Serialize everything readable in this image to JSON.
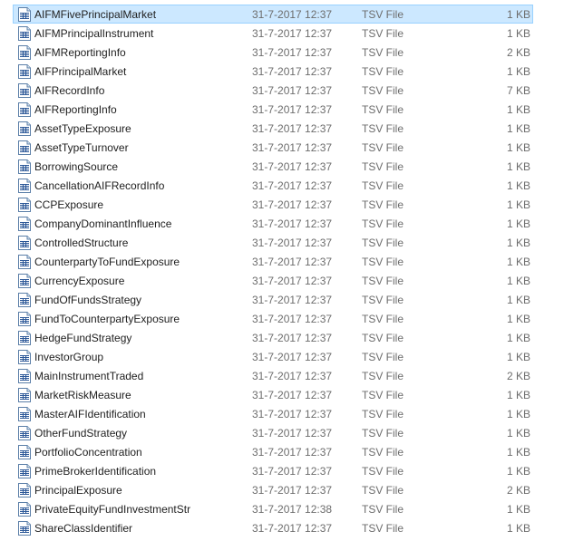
{
  "files": [
    {
      "name": "AIFMFivePrincipalMarket",
      "date": "31-7-2017 12:37",
      "type": "TSV File",
      "size": "1 KB",
      "selected": true
    },
    {
      "name": "AIFMPrincipalInstrument",
      "date": "31-7-2017 12:37",
      "type": "TSV File",
      "size": "1 KB"
    },
    {
      "name": "AIFMReportingInfo",
      "date": "31-7-2017 12:37",
      "type": "TSV File",
      "size": "2 KB"
    },
    {
      "name": "AIFPrincipalMarket",
      "date": "31-7-2017 12:37",
      "type": "TSV File",
      "size": "1 KB"
    },
    {
      "name": "AIFRecordInfo",
      "date": "31-7-2017 12:37",
      "type": "TSV File",
      "size": "7 KB"
    },
    {
      "name": "AIFReportingInfo",
      "date": "31-7-2017 12:37",
      "type": "TSV File",
      "size": "1 KB"
    },
    {
      "name": "AssetTypeExposure",
      "date": "31-7-2017 12:37",
      "type": "TSV File",
      "size": "1 KB"
    },
    {
      "name": "AssetTypeTurnover",
      "date": "31-7-2017 12:37",
      "type": "TSV File",
      "size": "1 KB"
    },
    {
      "name": "BorrowingSource",
      "date": "31-7-2017 12:37",
      "type": "TSV File",
      "size": "1 KB"
    },
    {
      "name": "CancellationAIFRecordInfo",
      "date": "31-7-2017 12:37",
      "type": "TSV File",
      "size": "1 KB"
    },
    {
      "name": "CCPExposure",
      "date": "31-7-2017 12:37",
      "type": "TSV File",
      "size": "1 KB"
    },
    {
      "name": "CompanyDominantInfluence",
      "date": "31-7-2017 12:37",
      "type": "TSV File",
      "size": "1 KB"
    },
    {
      "name": "ControlledStructure",
      "date": "31-7-2017 12:37",
      "type": "TSV File",
      "size": "1 KB"
    },
    {
      "name": "CounterpartyToFundExposure",
      "date": "31-7-2017 12:37",
      "type": "TSV File",
      "size": "1 KB"
    },
    {
      "name": "CurrencyExposure",
      "date": "31-7-2017 12:37",
      "type": "TSV File",
      "size": "1 KB"
    },
    {
      "name": "FundOfFundsStrategy",
      "date": "31-7-2017 12:37",
      "type": "TSV File",
      "size": "1 KB"
    },
    {
      "name": "FundToCounterpartyExposure",
      "date": "31-7-2017 12:37",
      "type": "TSV File",
      "size": "1 KB"
    },
    {
      "name": "HedgeFundStrategy",
      "date": "31-7-2017 12:37",
      "type": "TSV File",
      "size": "1 KB"
    },
    {
      "name": "InvestorGroup",
      "date": "31-7-2017 12:37",
      "type": "TSV File",
      "size": "1 KB"
    },
    {
      "name": "MainInstrumentTraded",
      "date": "31-7-2017 12:37",
      "type": "TSV File",
      "size": "2 KB"
    },
    {
      "name": "MarketRiskMeasure",
      "date": "31-7-2017 12:37",
      "type": "TSV File",
      "size": "1 KB"
    },
    {
      "name": "MasterAIFIdentification",
      "date": "31-7-2017 12:37",
      "type": "TSV File",
      "size": "1 KB"
    },
    {
      "name": "OtherFundStrategy",
      "date": "31-7-2017 12:37",
      "type": "TSV File",
      "size": "1 KB"
    },
    {
      "name": "PortfolioConcentration",
      "date": "31-7-2017 12:37",
      "type": "TSV File",
      "size": "1 KB"
    },
    {
      "name": "PrimeBrokerIdentification",
      "date": "31-7-2017 12:37",
      "type": "TSV File",
      "size": "1 KB"
    },
    {
      "name": "PrincipalExposure",
      "date": "31-7-2017 12:37",
      "type": "TSV File",
      "size": "2 KB"
    },
    {
      "name": "PrivateEquityFundInvestmentStr",
      "date": "31-7-2017 12:38",
      "type": "TSV File",
      "size": "1 KB"
    },
    {
      "name": "ShareClassIdentifier",
      "date": "31-7-2017 12:37",
      "type": "TSV File",
      "size": "1 KB"
    }
  ],
  "icon": "tsv-file-icon",
  "colors": {
    "selection_background": "#cce8ff",
    "selection_border": "#99d1ff",
    "name_text": "#1e1e1e",
    "detail_text": "#6d6d6d",
    "icon_accent": "#2b5797"
  }
}
